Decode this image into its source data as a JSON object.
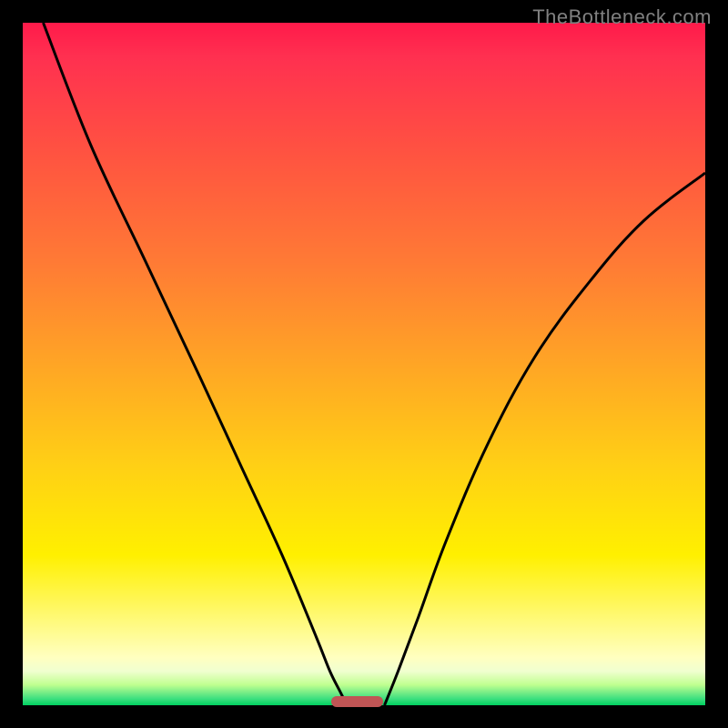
{
  "watermark": "TheBottleneck.com",
  "chart_data": {
    "type": "line",
    "title": "",
    "xlabel": "",
    "ylabel": "",
    "xlim": [
      0,
      100
    ],
    "ylim": [
      0,
      100
    ],
    "series": [
      {
        "name": "left-curve",
        "x": [
          3,
          10,
          18,
          26,
          32,
          38,
          43,
          45,
          46.5,
          47.5
        ],
        "y": [
          100,
          82,
          65,
          48,
          35,
          22,
          10,
          5,
          2,
          0
        ]
      },
      {
        "name": "right-curve",
        "x": [
          53,
          55,
          58,
          62,
          68,
          75,
          83,
          91,
          100
        ],
        "y": [
          0,
          5,
          13,
          24,
          38,
          51,
          62,
          71,
          78
        ]
      }
    ],
    "marker": {
      "x": 49,
      "y": 0.5,
      "width_pct": 7.7
    },
    "background_gradient": [
      "#ff1a4a",
      "#ff7a35",
      "#ffd015",
      "#fffa80",
      "#00d060"
    ]
  }
}
